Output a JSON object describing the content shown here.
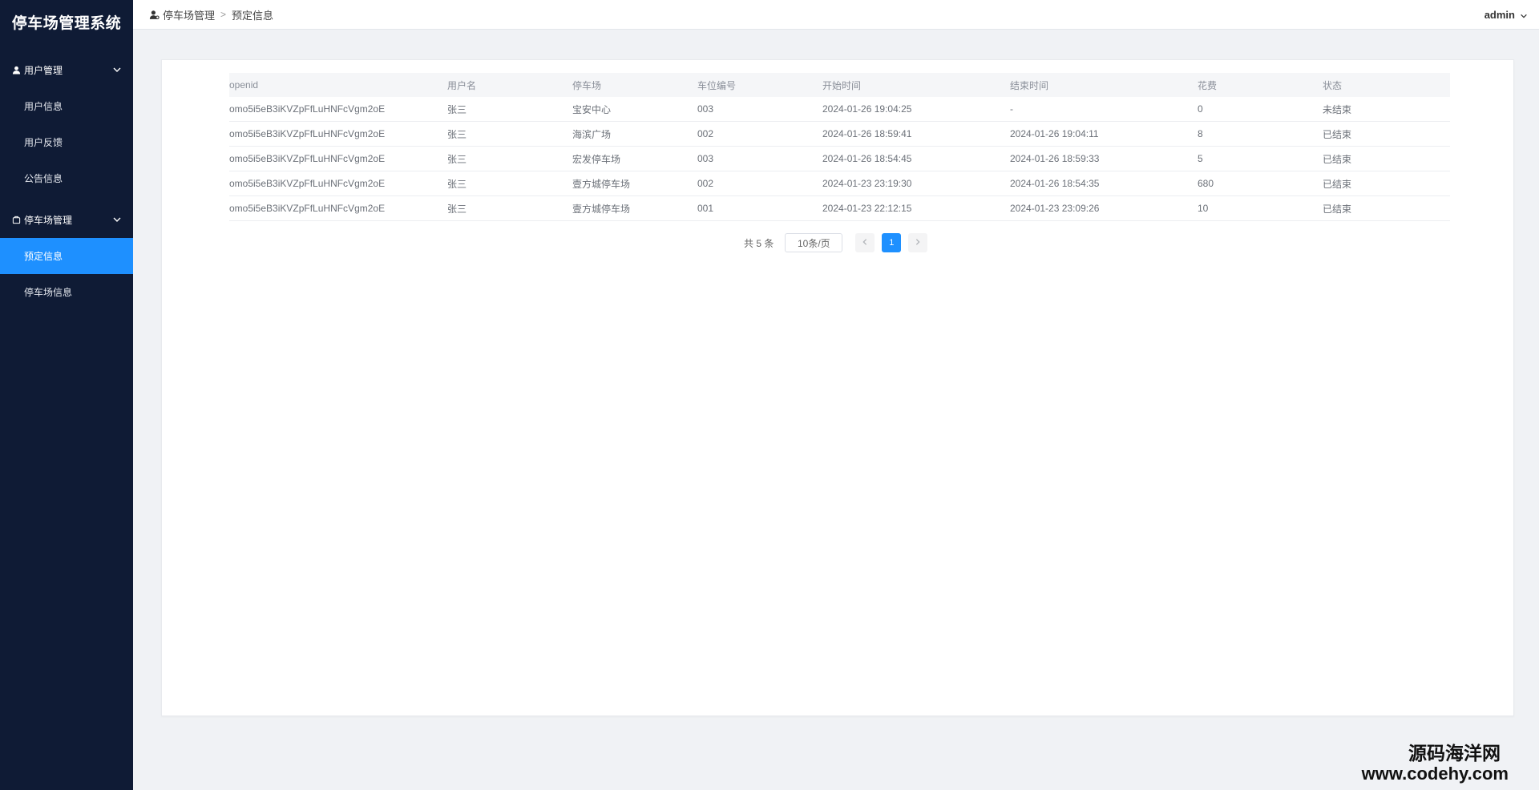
{
  "app": {
    "title": "停车场管理系统"
  },
  "sidebar": {
    "groups": [
      {
        "label": "用户管理",
        "icon": "user-icon",
        "items": [
          {
            "label": "用户信息"
          },
          {
            "label": "用户反馈"
          },
          {
            "label": "公告信息"
          }
        ]
      },
      {
        "label": "停车场管理",
        "icon": "parking-icon",
        "items": [
          {
            "label": "预定信息",
            "active": true
          },
          {
            "label": "停车场信息"
          }
        ]
      }
    ]
  },
  "header": {
    "breadcrumb": [
      "停车场管理",
      "预定信息"
    ],
    "user": "admin"
  },
  "table": {
    "columns": [
      "openid",
      "用户名",
      "停车场",
      "车位编号",
      "开始时间",
      "结束时间",
      "花费",
      "状态"
    ],
    "rows": [
      [
        "omo5i5eB3iKVZpFfLuHNFcVgm2oE",
        "张三",
        "宝安中心",
        "003",
        "2024-01-26 19:04:25",
        "-",
        "0",
        "未结束"
      ],
      [
        "omo5i5eB3iKVZpFfLuHNFcVgm2oE",
        "张三",
        "海滨广场",
        "002",
        "2024-01-26 18:59:41",
        "2024-01-26 19:04:11",
        "8",
        "已结束"
      ],
      [
        "omo5i5eB3iKVZpFfLuHNFcVgm2oE",
        "张三",
        "宏发停车场",
        "003",
        "2024-01-26 18:54:45",
        "2024-01-26 18:59:33",
        "5",
        "已结束"
      ],
      [
        "omo5i5eB3iKVZpFfLuHNFcVgm2oE",
        "张三",
        "壹方城停车场",
        "002",
        "2024-01-23 23:19:30",
        "2024-01-26 18:54:35",
        "680",
        "已结束"
      ],
      [
        "omo5i5eB3iKVZpFfLuHNFcVgm2oE",
        "张三",
        "壹方城停车场",
        "001",
        "2024-01-23 22:12:15",
        "2024-01-23 23:09:26",
        "10",
        "已结束"
      ]
    ]
  },
  "pagination": {
    "total": "共 5 条",
    "page_size": "10条/页",
    "current_page": "1",
    "prev_icon": "chevron-left-icon",
    "next_icon": "chevron-right-icon"
  },
  "watermark": {
    "line1": "源码海洋网",
    "line2": "www.codehy.com"
  },
  "colors": {
    "sidebar_bg": "#0f1b35",
    "accent": "#1e90ff",
    "page_bg": "#f0f2f5"
  }
}
